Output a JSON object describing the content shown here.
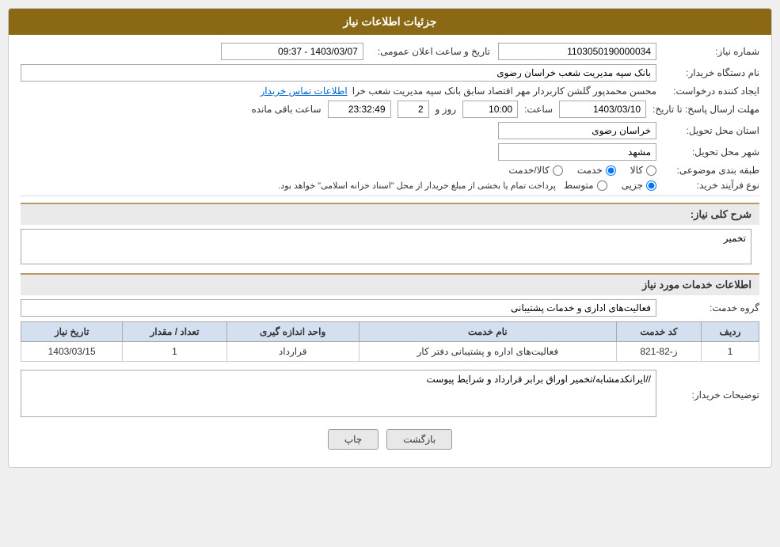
{
  "header": {
    "title": "جزئیات اطلاعات نیاز"
  },
  "fields": {
    "shenbare_niaz_label": "شماره نیاز:",
    "shenbare_niaz_value": "1103050190000034",
    "nam_dastaghah_label": "نام دستگاه خریدار:",
    "nam_dastaghah_value": "بانک سپه مدیریت شعب خراسان رضوی",
    "tarikh_label": "تاریخ و ساعت اعلان عمومی:",
    "tarikh_value": "1403/03/07 - 09:37",
    "ijad_label": "ایجاد کننده درخواست:",
    "ijad_value": "محسن محمدپور گلشن کاربردار مهر اقتصاد سابق بانک سپه مدیریت شعب خرا",
    "ijad_link": "اطلاعات تماس خریدار",
    "mohlat_label": "مهلت ارسال پاسخ: تا تاریخ:",
    "mohlat_date": "1403/03/10",
    "mohlat_saat_label": "ساعت:",
    "mohlat_saat": "10:00",
    "mohlat_rooz_label": "روز و",
    "mohlat_rooz": "2",
    "mohlat_baqi_label": "ساعت باقی مانده",
    "mohlat_baqi": "23:32:49",
    "ostan_label": "استان محل تحویل:",
    "ostan_value": "خراسان رضوی",
    "shahr_label": "شهر محل تحویل:",
    "shahr_value": "مشهد",
    "tabaqe_label": "طبقه بندی موضوعی:",
    "tabaqe_options": [
      "کالا",
      "خدمت",
      "کالا/خدمت"
    ],
    "tabaqe_selected": "خدمت",
    "nooe_label": "نوع فرآیند خرید:",
    "nooe_options": [
      "جزیی",
      "متوسط"
    ],
    "nooe_note": "پرداخت تمام یا بخشی از مبلغ خریدار از محل \"اسناد خزانه اسلامی\" خواهد بود.",
    "sharh_label": "شرح کلی نیاز:",
    "sharh_value": "تخمیر",
    "khadamat_header": "اطلاعات خدمات مورد نیاز",
    "gorohe_label": "گروه خدمت:",
    "gorohe_value": "فعالیت‌های اداری و خدمات پشتیبانی",
    "table_headers": [
      "ردیف",
      "کد خدمت",
      "نام خدمت",
      "واحد اندازه گیری",
      "تعداد / مقدار",
      "تاریخ نیاز"
    ],
    "table_rows": [
      {
        "radif": "1",
        "kod": "ز-82-821",
        "nam": "فعالیت‌های اداره و پشتیبانی دفتر کار",
        "vahed": "قرارداد",
        "tedad": "1",
        "tarikh": "1403/03/15"
      }
    ],
    "tozihat_label": "توضیحات خریدار:",
    "tozihat_value": "//ایرانکدمشابه/تخمیر اوراق برابر قرارداد و شرایط پیوست",
    "btn_print": "چاپ",
    "btn_back": "بازگشت"
  }
}
